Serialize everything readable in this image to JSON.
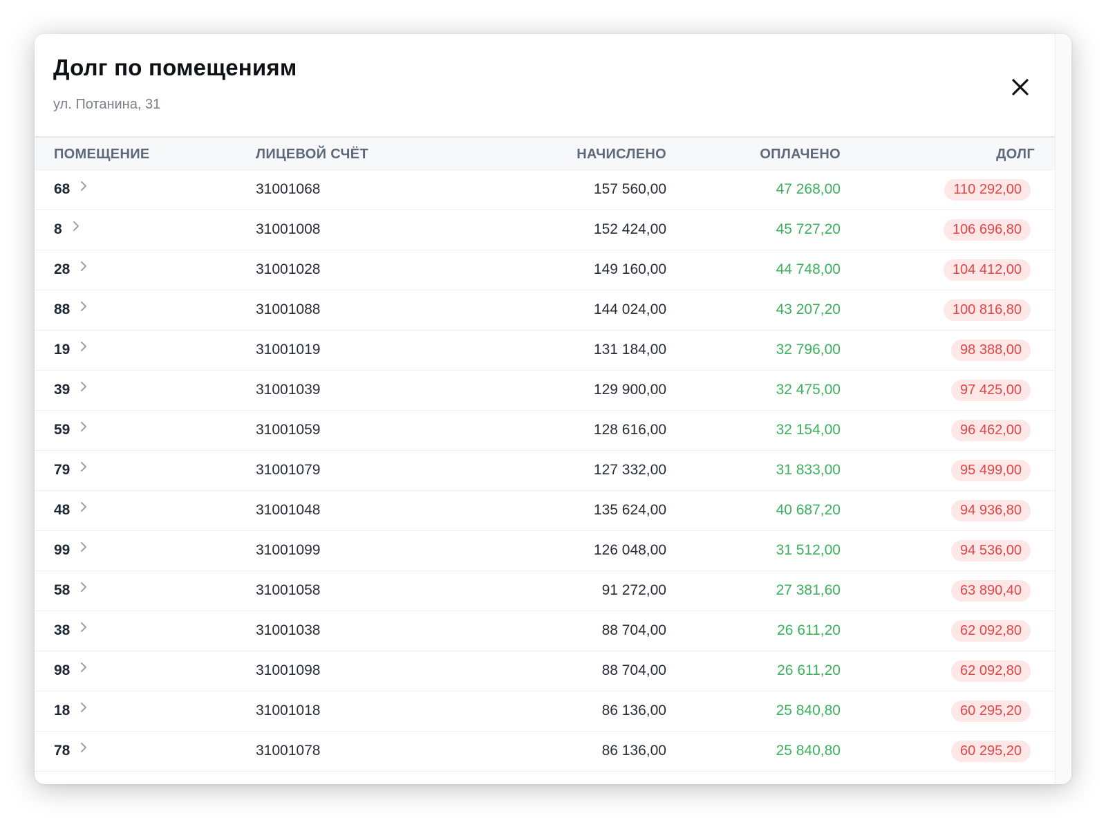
{
  "modal": {
    "title": "Долг по помещениям",
    "subtitle": "ул. Потанина, 31",
    "close_icon": "close-icon"
  },
  "table": {
    "columns": [
      "ПОМЕЩЕНИЕ",
      "ЛИЦЕВОЙ СЧЁТ",
      "НАЧИСЛЕНО",
      "ОПЛАЧЕНО",
      "ДОЛГ"
    ],
    "rows": [
      {
        "room": "68",
        "account": "31001068",
        "charged": "157 560,00",
        "paid": "47 268,00",
        "debt": "110 292,00"
      },
      {
        "room": "8",
        "account": "31001008",
        "charged": "152 424,00",
        "paid": "45 727,20",
        "debt": "106 696,80"
      },
      {
        "room": "28",
        "account": "31001028",
        "charged": "149 160,00",
        "paid": "44 748,00",
        "debt": "104 412,00"
      },
      {
        "room": "88",
        "account": "31001088",
        "charged": "144 024,00",
        "paid": "43 207,20",
        "debt": "100 816,80"
      },
      {
        "room": "19",
        "account": "31001019",
        "charged": "131 184,00",
        "paid": "32 796,00",
        "debt": "98 388,00"
      },
      {
        "room": "39",
        "account": "31001039",
        "charged": "129 900,00",
        "paid": "32 475,00",
        "debt": "97 425,00"
      },
      {
        "room": "59",
        "account": "31001059",
        "charged": "128 616,00",
        "paid": "32 154,00",
        "debt": "96 462,00"
      },
      {
        "room": "79",
        "account": "31001079",
        "charged": "127 332,00",
        "paid": "31 833,00",
        "debt": "95 499,00"
      },
      {
        "room": "48",
        "account": "31001048",
        "charged": "135 624,00",
        "paid": "40 687,20",
        "debt": "94 936,80"
      },
      {
        "room": "99",
        "account": "31001099",
        "charged": "126 048,00",
        "paid": "31 512,00",
        "debt": "94 536,00"
      },
      {
        "room": "58",
        "account": "31001058",
        "charged": "91 272,00",
        "paid": "27 381,60",
        "debt": "63 890,40"
      },
      {
        "room": "38",
        "account": "31001038",
        "charged": "88 704,00",
        "paid": "26 611,20",
        "debt": "62 092,80"
      },
      {
        "room": "98",
        "account": "31001098",
        "charged": "88 704,00",
        "paid": "26 611,20",
        "debt": "62 092,80"
      },
      {
        "room": "18",
        "account": "31001018",
        "charged": "86 136,00",
        "paid": "25 840,80",
        "debt": "60 295,20"
      },
      {
        "room": "78",
        "account": "31001078",
        "charged": "86 136,00",
        "paid": "25 840,80",
        "debt": "60 295,20"
      }
    ]
  },
  "colors": {
    "paid": "#3cb15d",
    "debt_text": "#e04646",
    "debt_badge_bg": "#fde7e7",
    "header_text": "#5d6878"
  },
  "icons": {
    "row_chevron": "chevron-right-icon"
  }
}
